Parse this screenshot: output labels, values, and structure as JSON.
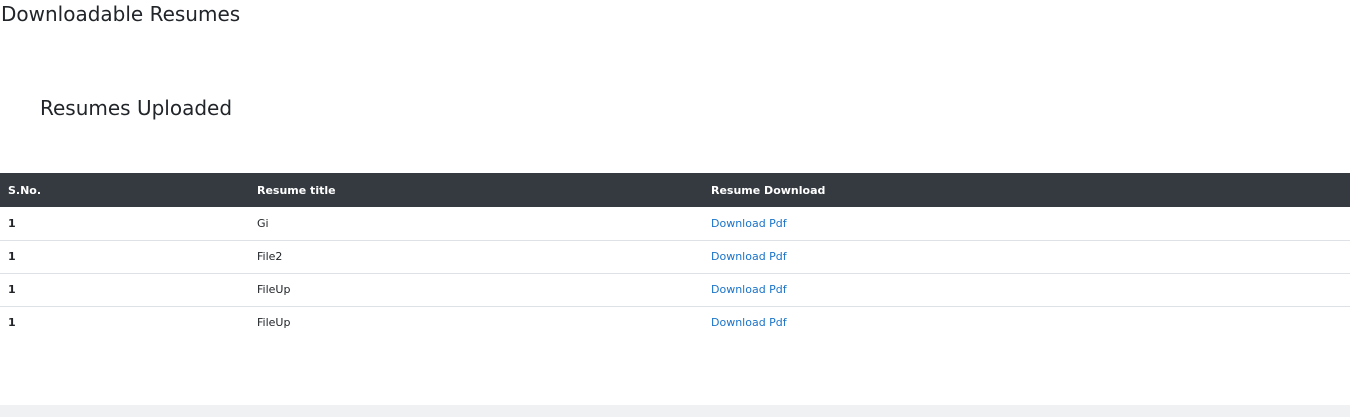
{
  "page": {
    "title": "Downloadable Resumes",
    "section_title": "Resumes Uploaded"
  },
  "table": {
    "headers": [
      "S.No.",
      "Resume title",
      "Resume Download"
    ],
    "rows": [
      {
        "sno": "1",
        "title": "Gi",
        "download": "Download Pdf"
      },
      {
        "sno": "1",
        "title": "File2",
        "download": "Download Pdf"
      },
      {
        "sno": "1",
        "title": "FileUp",
        "download": "Download Pdf"
      },
      {
        "sno": "1",
        "title": "FileUp",
        "download": "Download Pdf"
      }
    ]
  },
  "colors": {
    "header_bg": "#343a40",
    "link": "#1a73c8",
    "footer_bg": "#eff1f3"
  }
}
